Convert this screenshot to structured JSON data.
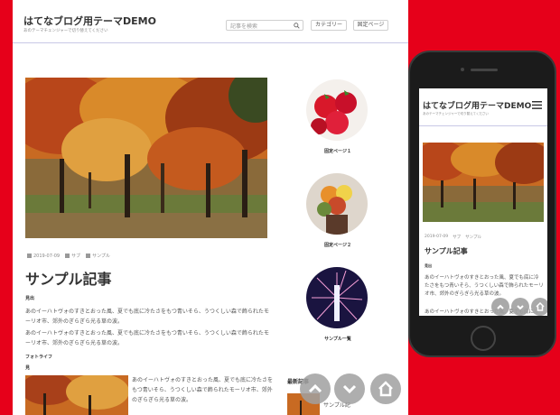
{
  "desktop": {
    "site_title": "はてなブログ用テーマDEMO",
    "site_desc": "あのテーマチェンジャーで切り替えてください",
    "search_placeholder": "記事を検索",
    "nav": {
      "category": "カテゴリー",
      "fixed_page": "固定ページ"
    },
    "meta": {
      "date": "2019-07-09",
      "cat1": "サブ",
      "cat2": "サンプル"
    },
    "post_title": "サンプル記事",
    "label_midashi": "見出",
    "para1": "あのイーハトヴォのすきとおった風、夏でも底に冷たさをもつ青いそら、うつくしい森で飾られたモーリオ市、郊外のぎらぎら光る草の波。",
    "para2": "あのイーハトヴォのすきとおった風、夏でも底に冷たさをもつ青いそら、うつくしい森で飾られたモーリオ市、郊外のぎらぎら光る草の波。",
    "label_photo": "フォトライフ",
    "label_ku": "見",
    "para3": "あのイーハトヴォのすきとおった風、夏でも底に冷たさをもつ青いそら、うつくしい森で飾られたモーリオ市、郊外のぎらぎら光る草の波。",
    "side_items": [
      "固定ページ１",
      "固定ページ２",
      "サンプル一覧"
    ],
    "recent_title": "最新記事",
    "recent_text": "サンプル記"
  },
  "mobile": {
    "site_title": "はてなブログ用テーマDEMO",
    "site_desc": "あのテーマチェンジャーで切り替えてください",
    "meta": {
      "date": "2019-07-09",
      "cat1": "サブ",
      "cat2": "サンプル"
    },
    "post_title": "サンプル記事",
    "label": "見出",
    "para1": "あのイーハトヴォのすきとおった風、夏でも底に冷たさをもつ青いそら、うつくしい森で飾られたモーリオ市、郊外のぎらぎら光る草の波。",
    "para2": "あのイーハトヴォのすきとおった風、夏でも底に冷たさをもつ青いそら、うつくしい森で飾られた"
  },
  "colors": {
    "background": "#e6001a",
    "header_border": "#c9c9e6",
    "fab": "#a0a0a0"
  },
  "icons": [
    "search-icon",
    "chevron-up-icon",
    "chevron-down-icon",
    "home-icon",
    "hamburger-menu-icon"
  ]
}
